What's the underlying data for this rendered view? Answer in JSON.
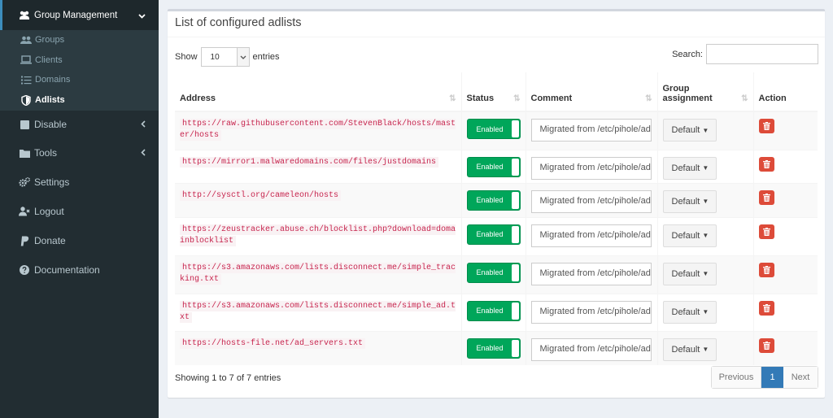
{
  "sidebar": {
    "group_management": "Group Management",
    "sub_items": [
      {
        "label": "Groups",
        "icon": "users-icon"
      },
      {
        "label": "Clients",
        "icon": "laptop-icon"
      },
      {
        "label": "Domains",
        "icon": "list-icon"
      },
      {
        "label": "Adlists",
        "icon": "shield-icon"
      }
    ],
    "items": [
      {
        "label": "Disable",
        "icon": "stop-icon"
      },
      {
        "label": "Tools",
        "icon": "folder-icon"
      },
      {
        "label": "Settings",
        "icon": "gears-icon"
      },
      {
        "label": "Logout",
        "icon": "user-times-icon"
      },
      {
        "label": "Donate",
        "icon": "paypal-icon"
      },
      {
        "label": "Documentation",
        "icon": "question-circle-icon"
      }
    ]
  },
  "box": {
    "title": "List of configured adlists",
    "show_label": "Show",
    "entries_label": "entries",
    "page_length": "10",
    "search_label": "Search:",
    "search_value": ""
  },
  "table": {
    "headers": {
      "address": "Address",
      "status": "Status",
      "comment": "Comment",
      "group_line1": "Group",
      "group_line2": "assignment",
      "action": "Action"
    },
    "rows": [
      {
        "address": "https://raw.githubusercontent.com/StevenBlack/hosts/master/hosts",
        "status": "Enabled",
        "comment": "Migrated from /etc/pihole/adlists.list",
        "group": "Default"
      },
      {
        "address": "https://mirror1.malwaredomains.com/files/justdomains",
        "status": "Enabled",
        "comment": "Migrated from /etc/pihole/adlists.list",
        "group": "Default"
      },
      {
        "address": "http://sysctl.org/cameleon/hosts",
        "status": "Enabled",
        "comment": "Migrated from /etc/pihole/adlists.list",
        "group": "Default"
      },
      {
        "address": "https://zeustracker.abuse.ch/blocklist.php?download=domainblocklist",
        "status": "Enabled",
        "comment": "Migrated from /etc/pihole/adlists.list",
        "group": "Default"
      },
      {
        "address": "https://s3.amazonaws.com/lists.disconnect.me/simple_tracking.txt",
        "status": "Enabled",
        "comment": "Migrated from /etc/pihole/adlists.list",
        "group": "Default"
      },
      {
        "address": "https://s3.amazonaws.com/lists.disconnect.me/simple_ad.txt",
        "status": "Enabled",
        "comment": "Migrated from /etc/pihole/adlists.list",
        "group": "Default"
      },
      {
        "address": "https://hosts-file.net/ad_servers.txt",
        "status": "Enabled",
        "comment": "Migrated from /etc/pihole/adlists.list",
        "group": "Default"
      }
    ]
  },
  "footer": {
    "info": "Showing 1 to 7 of 7 entries",
    "previous": "Previous",
    "current_page": "1",
    "next": "Next"
  },
  "colors": {
    "sidebar_bg": "#222d32",
    "enabled_green": "#00a65a",
    "delete_red": "#dd4b39",
    "pager_active": "#337ab7",
    "address_pink": "#c7254e"
  }
}
